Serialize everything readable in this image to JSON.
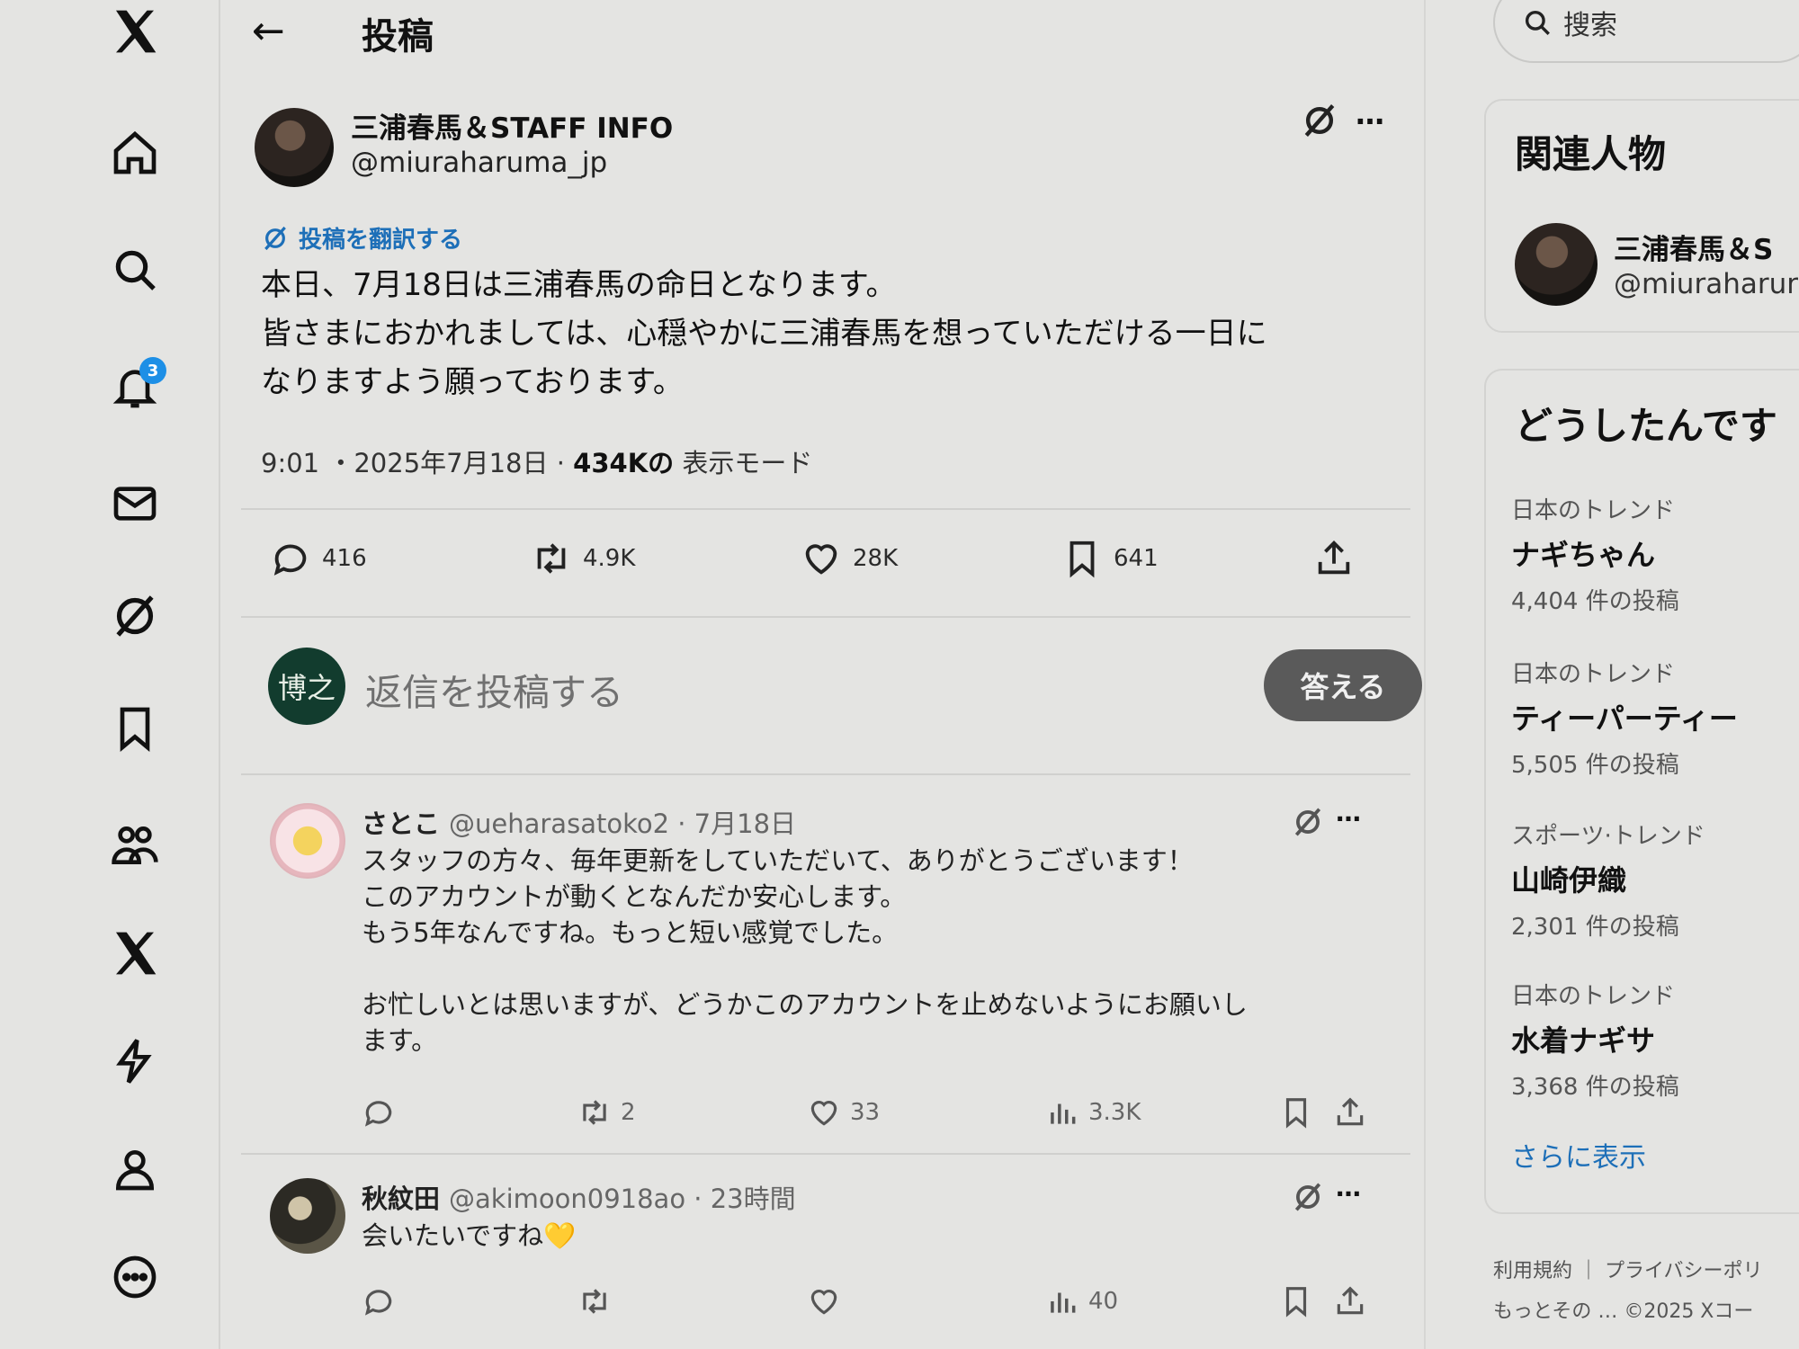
{
  "nav": {
    "notification_badge": "3",
    "icons": [
      "x-logo-icon",
      "home-icon",
      "search-icon",
      "bell-icon",
      "mail-icon",
      "grok-icon",
      "bookmark-icon",
      "communities-icon",
      "x-premium-icon",
      "lightning-icon",
      "profile-icon",
      "more-icon"
    ]
  },
  "header": {
    "back": "←",
    "title": "投稿"
  },
  "post": {
    "author_name": "三浦春馬＆STAFF INFO",
    "author_handle": "@miuraharuma_jp",
    "more": "…",
    "translate": "投稿を翻訳する",
    "text_lines": [
      "本日、7月18日は三浦春馬の命日となります。",
      "皆さまにおかれましては、心穏やかに三浦春馬を想っていただける一日に",
      "なりますよう願っております。"
    ],
    "time": "9:01 ・2025年7月18日 · ",
    "views": "434Kの",
    "views_label": " 表示モード",
    "actions": {
      "replies": "416",
      "reposts": "4.9K",
      "likes": "28K",
      "bookmarks": "641"
    }
  },
  "reply_composer": {
    "avatar_text": "博之",
    "placeholder": "返信を投稿する",
    "button": "答える"
  },
  "replies": [
    {
      "name": "さとこ",
      "handle_time": "@ueharasatoko2 · 7月18日",
      "lines": [
        "スタッフの方々、毎年更新をしていただいて、ありがとうございます！",
        "このアカウントが動くとなんだか安心します。",
        "もう5年なんですね。もっと短い感覚でした。",
        "",
        "お忙しいとは思いますが、どうかこのアカウントを止めないようにお願いし",
        "ます。"
      ],
      "reposts": "2",
      "likes": "33",
      "views": "3.3K"
    },
    {
      "name": "秋紋田",
      "handle_time": "@akimoon0918ao · 23時間",
      "lines": [
        "会いたいですね💛"
      ],
      "views": "40"
    }
  ],
  "sidebar": {
    "search_placeholder": "搜索",
    "related_title": "関連人物",
    "related_name": "三浦春馬＆S",
    "related_handle": "@miuraharur",
    "trends_title": "どうしたんです",
    "trends": [
      {
        "category": "日本のトレンド",
        "name": "ナギちゃん",
        "count": "4,404 件の投稿"
      },
      {
        "category": "日本のトレンド",
        "name": "ティーパーティー",
        "count": "5,505 件の投稿"
      },
      {
        "category": "スポーツ·トレンド",
        "name": "山崎伊織",
        "count": "2,301 件の投稿"
      },
      {
        "category": "日本のトレンド",
        "name": "水着ナギサ",
        "count": "3,368 件の投稿"
      }
    ],
    "show_more": "さらに表示",
    "footer_line1": "利用規約 ｜ プライバシーポリ",
    "footer_line2": "もっとその … ©2025 Xコー"
  },
  "colors": {
    "accent_blue": "#1d6fb8",
    "badge_blue": "#1d8fe6",
    "reply_button": "#5a5a5a"
  }
}
